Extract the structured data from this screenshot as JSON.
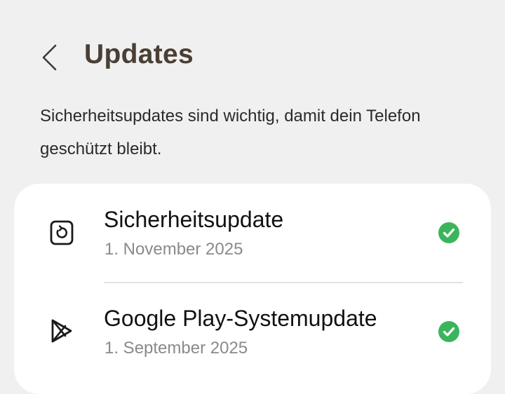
{
  "header": {
    "title": "Updates",
    "back_icon": "chevron-left-icon"
  },
  "description": "Sicherheitsupdates sind wichtig, damit dein Telefon geschützt bleibt.",
  "updates": [
    {
      "title": "Sicherheitsupdate",
      "date": "1. November 2025",
      "icon": "security-update-icon",
      "status": "up-to-date"
    },
    {
      "title": "Google Play-Systemupdate",
      "date": "1. September 2025",
      "icon": "google-play-icon",
      "status": "up-to-date"
    }
  ],
  "colors": {
    "background": "#f0f0f0",
    "card": "#ffffff",
    "title": "#4a3f35",
    "check_green": "#3bb55c"
  }
}
